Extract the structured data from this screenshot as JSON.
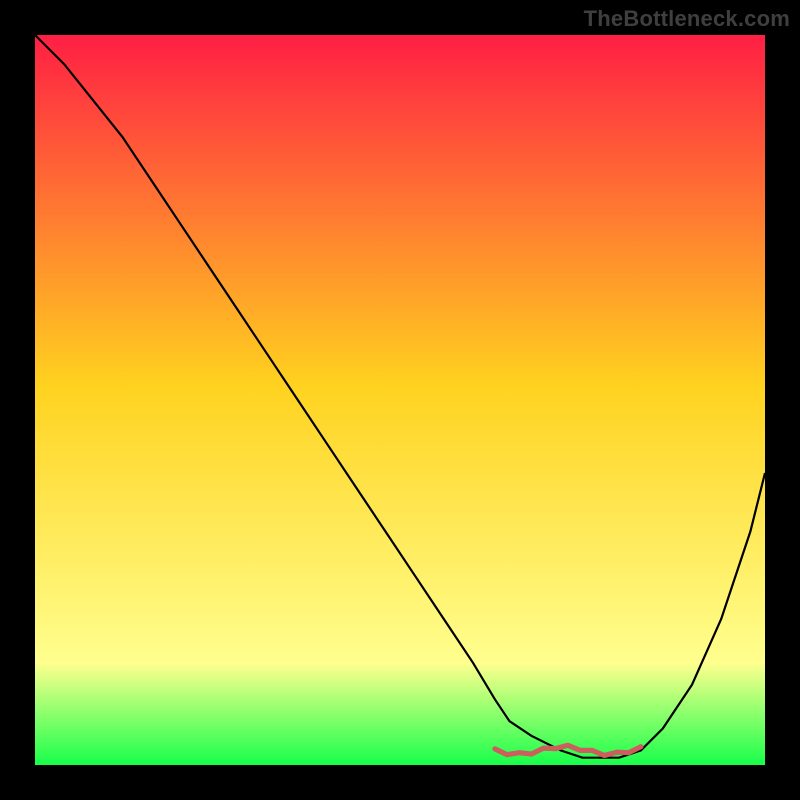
{
  "watermark": "TheBottleneck.com",
  "colors": {
    "gradient_top": "#ff1f44",
    "gradient_mid": "#ffd21f",
    "gradient_band": "#ffff8e",
    "gradient_bottom": "#17ff4a",
    "curve": "#000000",
    "doodle": "#cc5e5e",
    "background": "#000000"
  },
  "chart_data": {
    "type": "line",
    "title": "",
    "xlabel": "",
    "ylabel": "",
    "x": [
      0,
      4,
      8,
      12,
      16,
      20,
      24,
      28,
      32,
      36,
      40,
      44,
      48,
      52,
      56,
      60,
      63,
      65,
      68,
      72,
      75,
      78,
      80,
      83,
      86,
      90,
      94,
      98,
      100
    ],
    "values": [
      100,
      96,
      91,
      86,
      80,
      74,
      68,
      62,
      56,
      50,
      44,
      38,
      32,
      26,
      20,
      14,
      9,
      6,
      4,
      2,
      1,
      1,
      1,
      2,
      5,
      11,
      20,
      32,
      40
    ],
    "xlim": [
      0,
      100
    ],
    "ylim": [
      0,
      100
    ],
    "annotations": [
      {
        "kind": "scribble",
        "x_range": [
          63,
          83
        ],
        "y": 2,
        "color": "#cc5e5e"
      }
    ]
  }
}
